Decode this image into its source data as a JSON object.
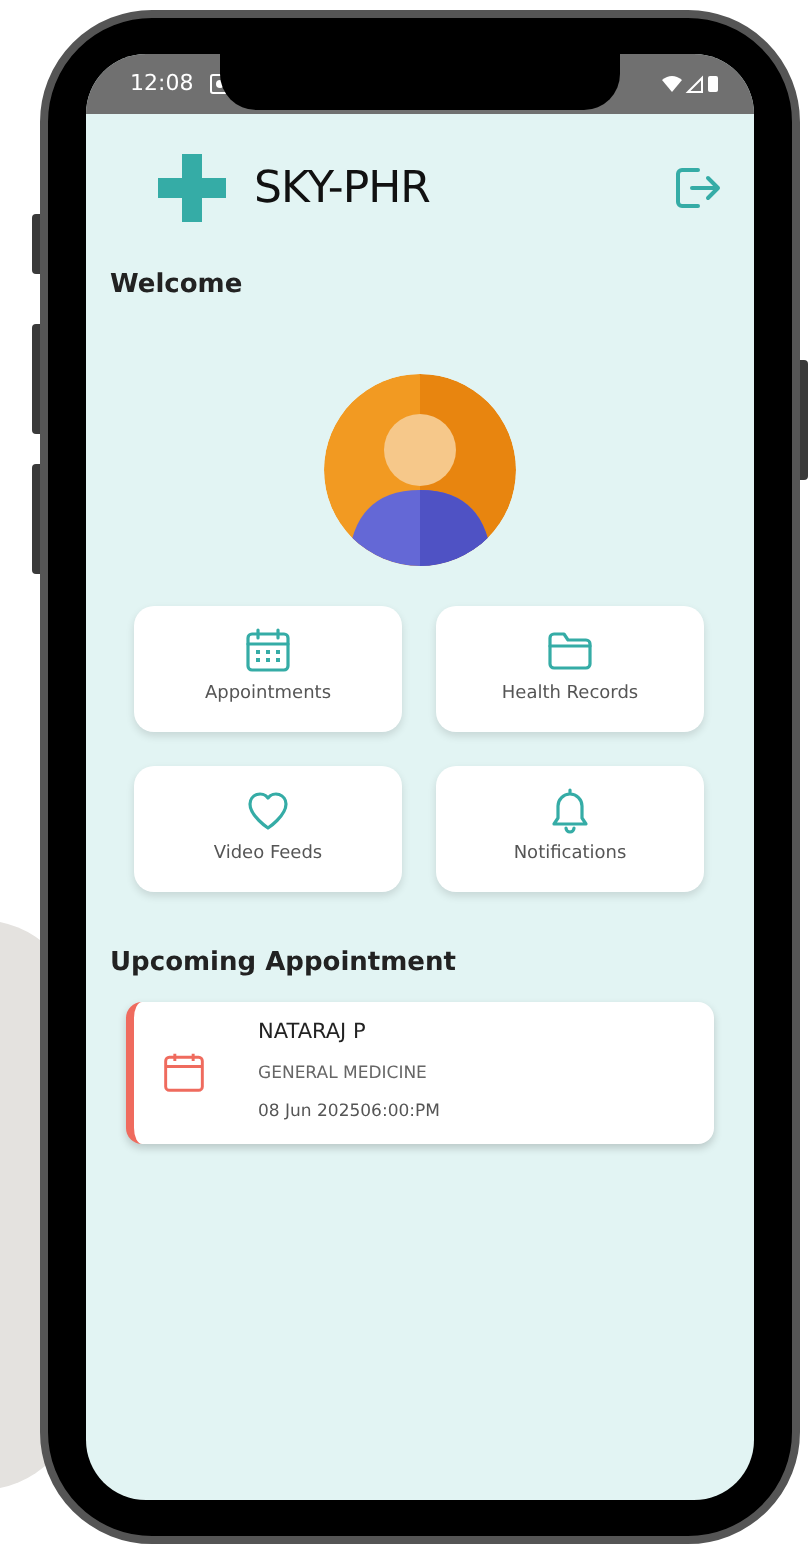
{
  "status_bar": {
    "time": "12:08"
  },
  "header": {
    "title": "SKY-PHR"
  },
  "welcome": "Welcome",
  "menu": [
    {
      "label": "Appointments",
      "kind": "calendar"
    },
    {
      "label": "Health Records",
      "kind": "folder"
    },
    {
      "label": "Video Feeds",
      "kind": "heart"
    },
    {
      "label": "Notifications",
      "kind": "bell"
    }
  ],
  "upcoming": {
    "title": "Upcoming Appointment",
    "appointments": [
      {
        "name": "NATARAJ P",
        "department": "GENERAL MEDICINE",
        "datetime": "08 Jun 202506:00:PM"
      }
    ]
  }
}
